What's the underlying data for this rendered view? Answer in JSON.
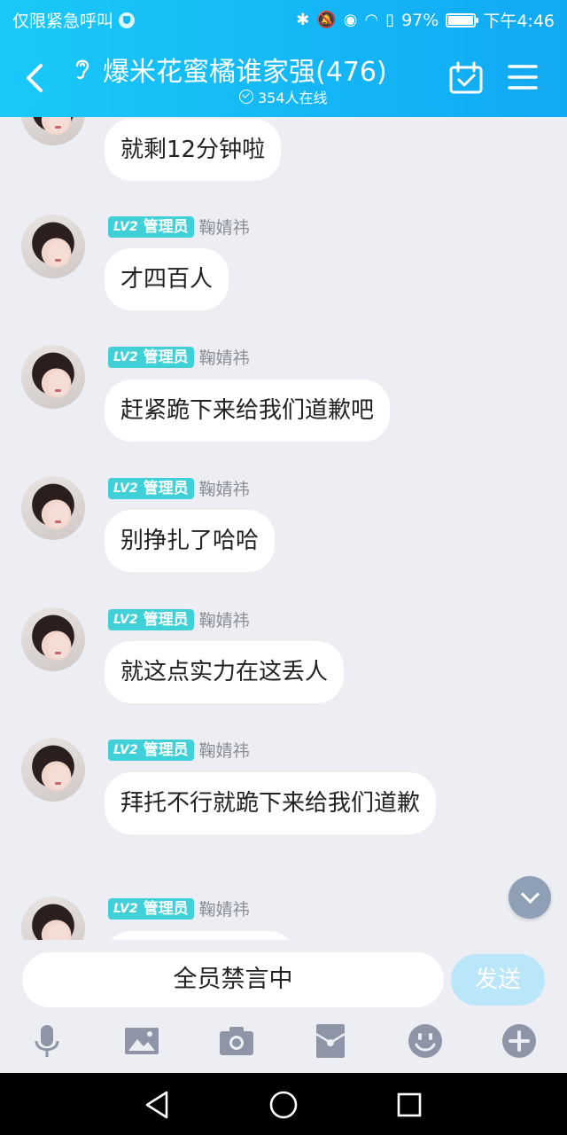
{
  "status_bar": {
    "carrier_text": "仅限紧急呼叫",
    "battery_percent": "97%",
    "battery_level": 0.97,
    "time": "下午4:46"
  },
  "header": {
    "title": "爆米花蜜橘谁家强(476)",
    "online_text": "354人在线"
  },
  "messages": [
    {
      "text": "就剩12分钟啦"
    },
    {
      "badge_level": "LV2",
      "badge_role": "管理员",
      "nickname": "鞠婧祎",
      "text": "才四百人"
    },
    {
      "badge_level": "LV2",
      "badge_role": "管理员",
      "nickname": "鞠婧祎",
      "text": "赶紧跪下来给我们道歉吧"
    },
    {
      "badge_level": "LV2",
      "badge_role": "管理员",
      "nickname": "鞠婧祎",
      "text": "别挣扎了哈哈"
    },
    {
      "badge_level": "LV2",
      "badge_role": "管理员",
      "nickname": "鞠婧祎",
      "text": "就这点实力在这丢人"
    },
    {
      "badge_level": "LV2",
      "badge_role": "管理员",
      "nickname": "鞠婧祎",
      "text": "拜托不行就跪下来给我们道歉"
    },
    {
      "badge_level": "LV2",
      "badge_role": "管理员",
      "nickname": "鞠婧祎",
      "text": ""
    }
  ],
  "input": {
    "mute_text": "全员禁言中",
    "send_label": "发送"
  },
  "toolbar_icons": [
    "microphone-icon",
    "image-icon",
    "camera-icon",
    "red-packet-icon",
    "emoji-icon",
    "plus-icon"
  ],
  "colors": {
    "header_gradient_start": "#19c9f8",
    "header_gradient_end": "#11a9f3",
    "badge": "#3fd0d8",
    "send_disabled": "#b9e6f8",
    "chat_background": "#eceef4"
  }
}
